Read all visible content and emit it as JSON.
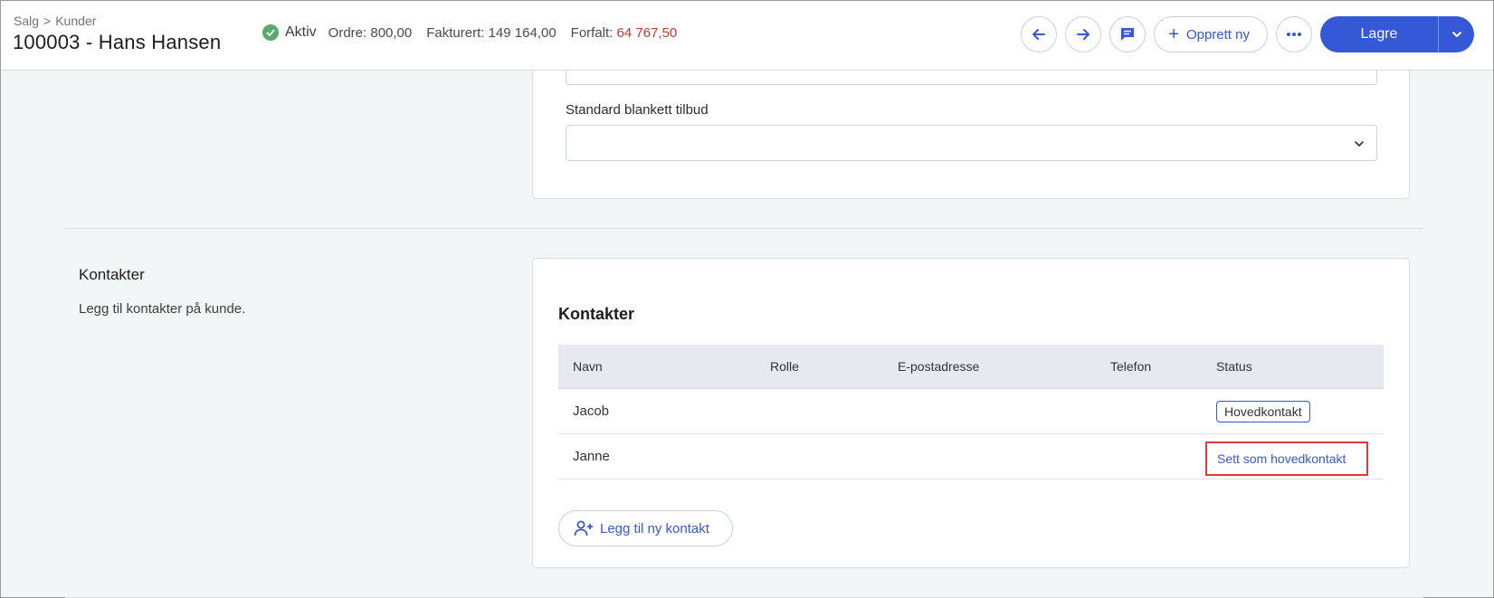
{
  "breadcrumb": {
    "part1": "Salg",
    "separator": ">",
    "part2": "Kunder"
  },
  "page_title": "100003 - Hans Hansen",
  "status": {
    "label": "Aktiv",
    "ordre": "Ordre: 800,00",
    "fakturert": "Fakturert: 149 164,00",
    "forfalt_label": "Forfalt:",
    "forfalt_value": "64 767,50"
  },
  "toolbar": {
    "create_label": "Opprett ny",
    "save_label": "Lagre"
  },
  "upper_card": {
    "field_label": "Standard blankett tilbud",
    "field_value": ""
  },
  "contacts_section": {
    "title": "Kontakter",
    "description": "Legg til kontakter på kunde."
  },
  "contacts_card": {
    "heading": "Kontakter",
    "columns": [
      "Navn",
      "Rolle",
      "E-postadresse",
      "Telefon",
      "Status"
    ],
    "rows": [
      {
        "navn": "Jacob",
        "rolle": "",
        "epost": "",
        "telefon": "",
        "status": "Hovedkontakt"
      },
      {
        "navn": "Janne",
        "rolle": "",
        "epost": "",
        "telefon": "",
        "status": "Sett som hovedkontakt"
      }
    ],
    "add_label": "Legg til ny kontakt"
  },
  "colors": {
    "accent": "#3558d6",
    "success": "#59a96a",
    "overdue": "#c0392b",
    "highlight": "#e03a3a"
  },
  "icons": [
    "check-circle-icon",
    "arrow-left-icon",
    "arrow-right-icon",
    "chat-icon",
    "plus-icon",
    "more-icon",
    "chevron-down-icon",
    "add-user-icon"
  ]
}
